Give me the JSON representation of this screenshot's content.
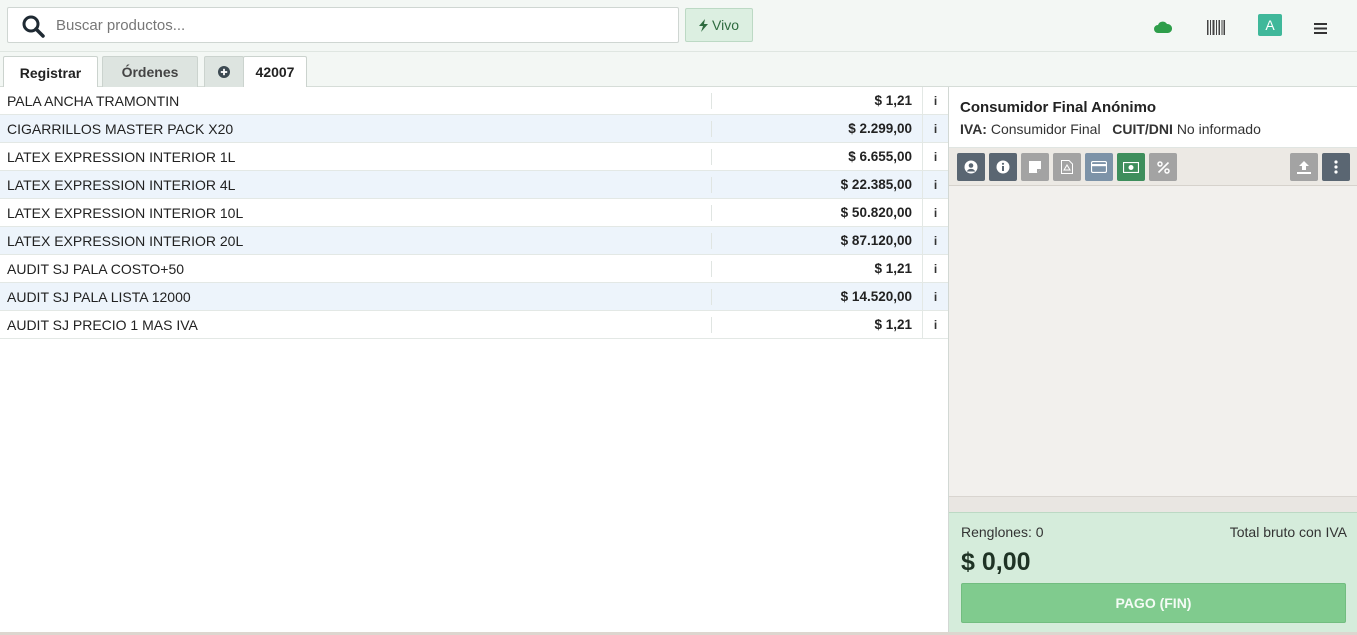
{
  "search": {
    "placeholder": "Buscar productos...",
    "value": ""
  },
  "header": {
    "live_label": "Vivo",
    "avatar_letter": "A",
    "icons": [
      "search-icon",
      "bolt-icon",
      "cloud-icon",
      "barcode-icon",
      "menu-icon"
    ]
  },
  "tabs": {
    "registrar": "Registrar",
    "ordenes": "Órdenes",
    "order_number": "42007"
  },
  "products": [
    {
      "name": "PALA ANCHA TRAMONTIN",
      "price": "$ 1,21",
      "info": "i"
    },
    {
      "name": "CIGARRILLOS MASTER PACK X20",
      "price": "$ 2.299,00",
      "info": "i"
    },
    {
      "name": "LATEX EXPRESSION INTERIOR 1L",
      "price": "$ 6.655,00",
      "info": "i"
    },
    {
      "name": "LATEX EXPRESSION INTERIOR 4L",
      "price": "$ 22.385,00",
      "info": "i"
    },
    {
      "name": "LATEX EXPRESSION INTERIOR 10L",
      "price": "$ 50.820,00",
      "info": "i"
    },
    {
      "name": "LATEX EXPRESSION INTERIOR 20L",
      "price": "$ 87.120,00",
      "info": "i"
    },
    {
      "name": "AUDIT SJ PALA COSTO+50",
      "price": "$ 1,21",
      "info": "i"
    },
    {
      "name": "AUDIT SJ PALA LISTA 12000",
      "price": "$ 14.520,00",
      "info": "i"
    },
    {
      "name": "AUDIT SJ PRECIO 1 MAS IVA",
      "price": "$ 1,21",
      "info": "i"
    }
  ],
  "customer": {
    "name": "Consumidor Final Anónimo",
    "iva_label": "IVA:",
    "iva_value": "Consumidor Final",
    "doc_label": "CUIT/DNI",
    "doc_value": "No informado"
  },
  "toolbar_icons": [
    "user-icon",
    "info-icon",
    "note-icon",
    "pdf-icon",
    "card-icon",
    "cash-icon",
    "percent-icon",
    "upload-icon",
    "more-icon"
  ],
  "summary": {
    "lines": "Renglones: 0",
    "total_label": "Total bruto con IVA",
    "total": "$ 0,00",
    "pay_label": "PAGO (FIN)"
  },
  "colors": {
    "accent_green": "#80cb8e",
    "avatar": "#3fb89a",
    "cloud": "#2e9e4a"
  }
}
